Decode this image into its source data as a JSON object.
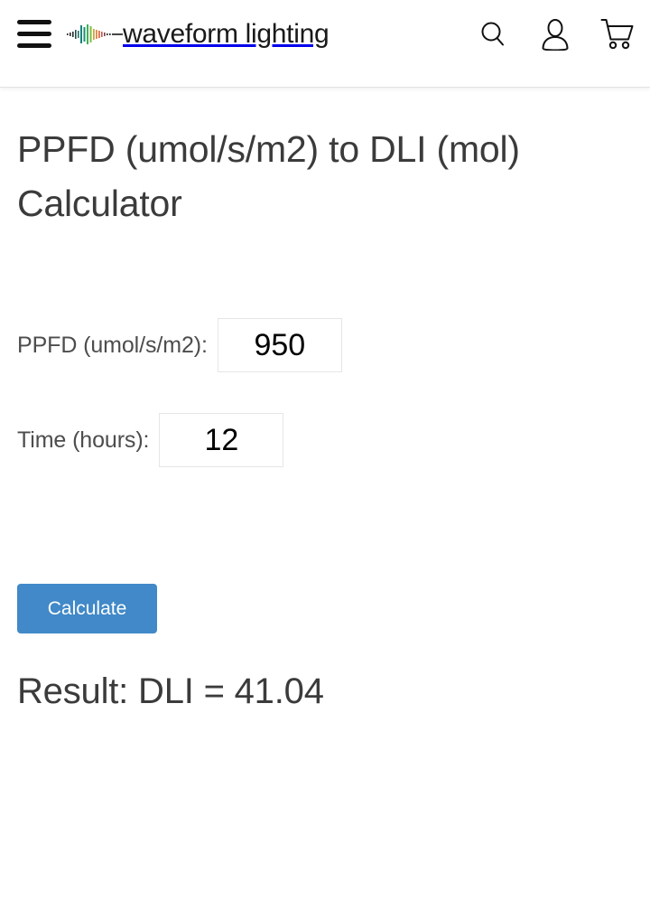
{
  "header": {
    "menu_icon": "hamburger-menu-icon",
    "brand_name": "waveform lighting",
    "brand_logo_icon": "waveform-logo-icon",
    "icons": [
      {
        "name": "search-icon",
        "label": "Search"
      },
      {
        "name": "account-icon",
        "label": "Account"
      },
      {
        "name": "cart-icon",
        "label": "Cart"
      }
    ]
  },
  "main": {
    "title": "PPFD (umol/s/m2) to DLI (mol) Calculator",
    "fields": [
      {
        "label": "PPFD (umol/s/m2):",
        "value": "950",
        "placeholder": ""
      },
      {
        "label": "Time (hours):",
        "value": "12",
        "placeholder": ""
      }
    ],
    "calculate_label": "Calculate",
    "result_text": "Result: DLI = 41.04"
  },
  "colors": {
    "button_blue": "#4189c8",
    "title_gray": "#3b3b3b",
    "label_gray": "#4d4d4d",
    "input_border": "#e6e6e6",
    "header_border": "#e2e2e2"
  }
}
